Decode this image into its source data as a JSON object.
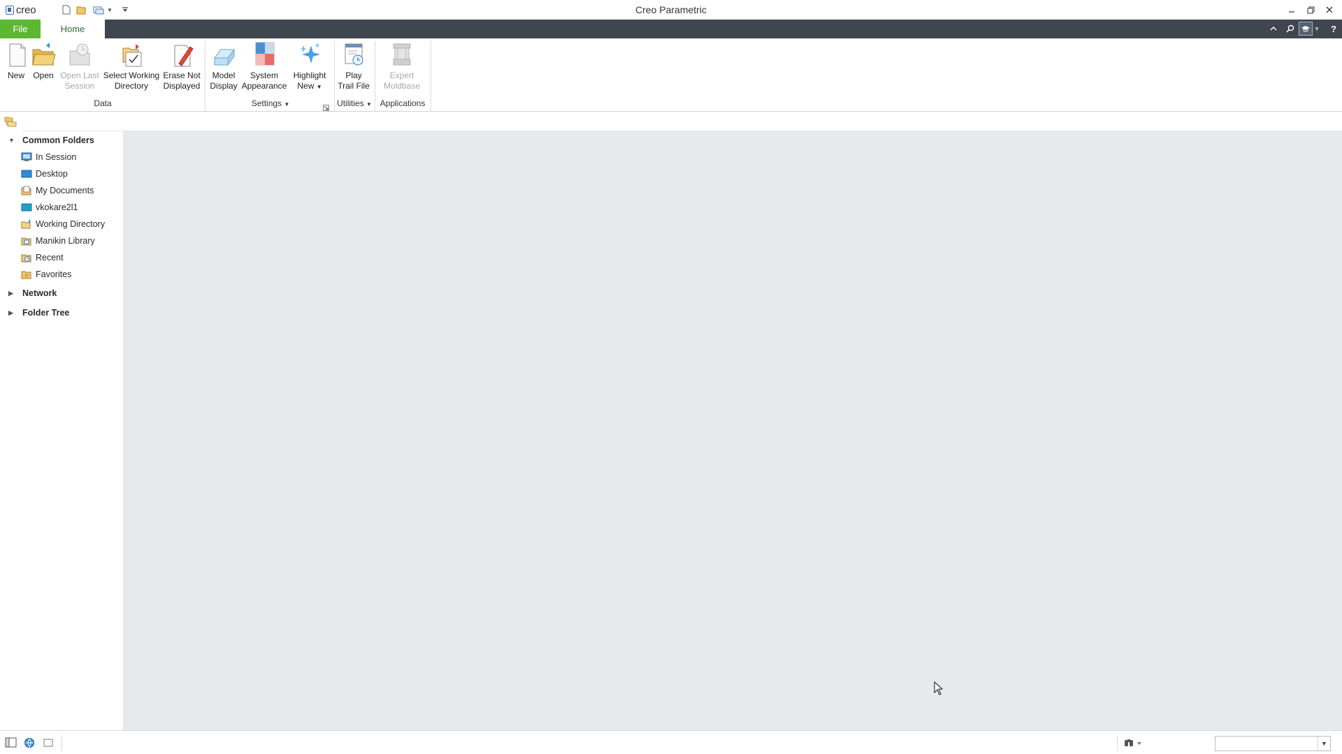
{
  "window": {
    "title": "Creo Parametric",
    "logo_text": "creo"
  },
  "ribbon_tabs": [
    {
      "label": "File"
    },
    {
      "label": "Home"
    }
  ],
  "ribbon": {
    "data_group": {
      "label": "Data",
      "buttons": [
        {
          "line1": "New",
          "line2": "",
          "enabled": true,
          "icon": "new-file-icon"
        },
        {
          "line1": "Open",
          "line2": "",
          "enabled": true,
          "icon": "open-folder-icon"
        },
        {
          "line1": "Open Last",
          "line2": "Session",
          "enabled": false,
          "icon": "open-last-session-icon"
        },
        {
          "line1": "Select Working",
          "line2": "Directory",
          "enabled": true,
          "icon": "select-working-directory-icon"
        },
        {
          "line1": "Erase Not",
          "line2": "Displayed",
          "enabled": true,
          "icon": "erase-not-displayed-icon"
        }
      ]
    },
    "settings_group": {
      "label": "Settings",
      "buttons": [
        {
          "line1": "Model",
          "line2": "Display",
          "enabled": true,
          "icon": "model-display-icon"
        },
        {
          "line1": "System",
          "line2": "Appearance",
          "enabled": true,
          "icon": "system-appearance-icon"
        },
        {
          "line1": "Highlight",
          "line2": "New",
          "enabled": true,
          "icon": "highlight-new-icon"
        }
      ]
    },
    "utilities_group": {
      "label": "Utilities",
      "buttons": [
        {
          "line1": "Play",
          "line2": "Trail File",
          "enabled": true,
          "icon": "play-trail-file-icon"
        }
      ]
    },
    "applications_group": {
      "label": "Applications",
      "buttons": [
        {
          "line1": "Expert",
          "line2": "Moldbase",
          "enabled": false,
          "icon": "expert-moldbase-icon"
        }
      ]
    }
  },
  "navigator": {
    "common_folders": {
      "label": "Common Folders",
      "expanded": true,
      "items": [
        {
          "label": "In Session",
          "icon": "in-session-icon"
        },
        {
          "label": "Desktop",
          "icon": "desktop-icon"
        },
        {
          "label": "My Documents",
          "icon": "my-documents-icon"
        },
        {
          "label": "vkokare2l1",
          "icon": "computer-icon"
        },
        {
          "label": "Working Directory",
          "icon": "working-directory-icon"
        },
        {
          "label": "Manikin Library",
          "icon": "manikin-library-icon"
        },
        {
          "label": "Recent",
          "icon": "recent-icon"
        },
        {
          "label": "Favorites",
          "icon": "favorites-icon"
        }
      ]
    },
    "network": {
      "label": "Network",
      "expanded": false
    },
    "folder_tree": {
      "label": "Folder Tree",
      "expanded": false
    }
  },
  "statusbar": {
    "filter_value": ""
  }
}
